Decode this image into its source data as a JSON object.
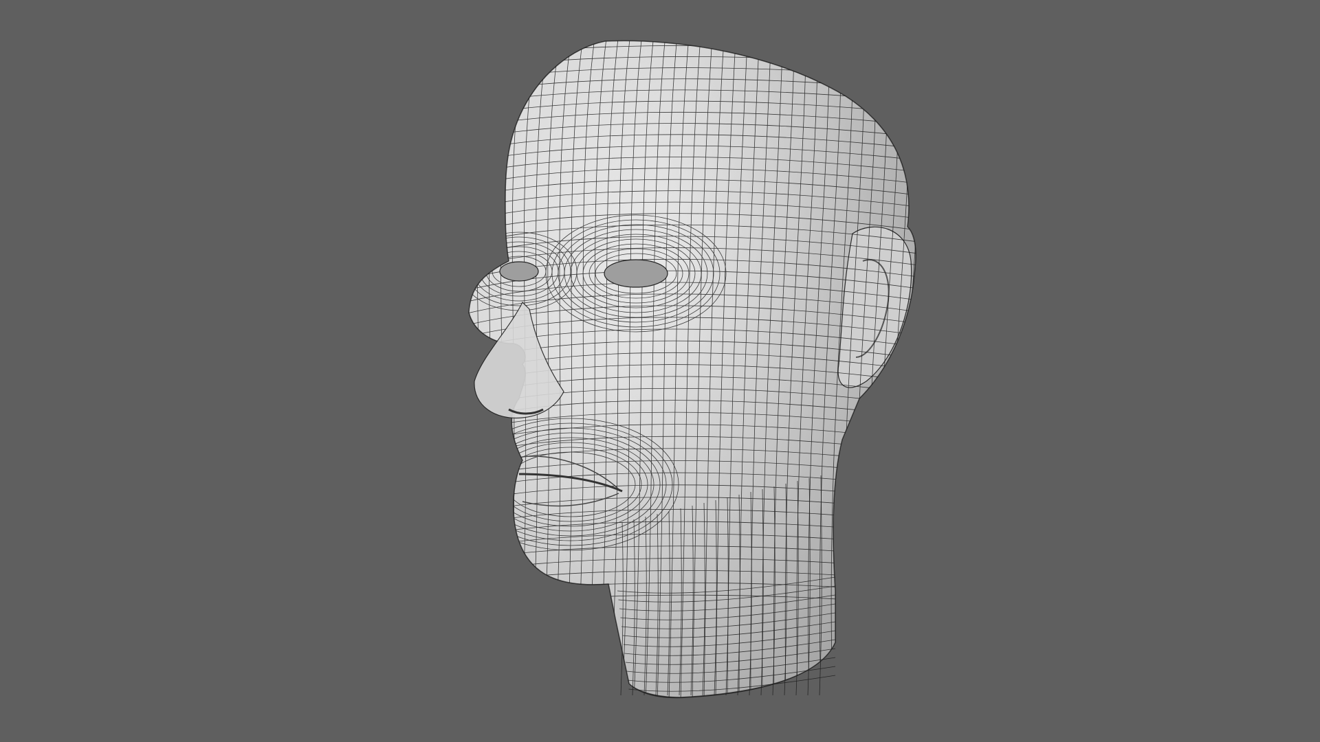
{
  "scene": {
    "background_color": "#5f5f5f",
    "subject": "head-mesh",
    "display_mode": "wireframe-on-shaded",
    "surface_color": "#e4e4e4",
    "shadow_color": "#9a9a9a",
    "wire_color": "#1c1c1c"
  }
}
